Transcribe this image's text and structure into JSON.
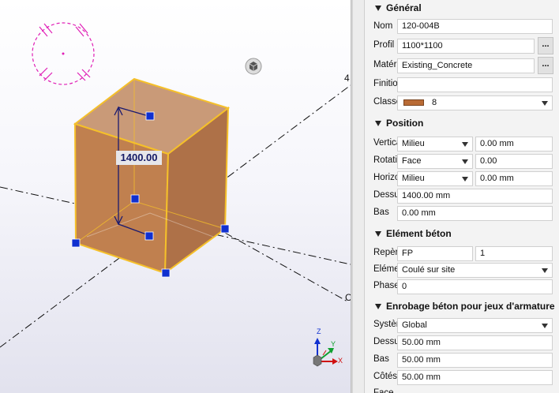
{
  "viewport": {
    "dimension_value": "1400.00",
    "edge_number_top": "4",
    "edge_number_bottom": "C",
    "axes": {
      "z": "Z",
      "y": "Y",
      "x": "X"
    },
    "colors": {
      "solid_fill": "#b87a4e",
      "highlight": "#f5c02a",
      "handle": "#1030d0",
      "dim_line": "#1a1a70"
    }
  },
  "panel": {
    "general": {
      "title": "Général",
      "nom_label": "Nom",
      "nom_value": "120-004B",
      "profil_label": "Profil",
      "profil_value": "1100*1100",
      "profil_button": "...",
      "materiau_label": "Matériau",
      "materiau_value": "Existing_Concrete",
      "materiau_button": "...",
      "finition_label": "Finition",
      "finition_value": "",
      "classe_label": "Classe",
      "classe_value": "8",
      "classe_color": "#b96b35"
    },
    "position": {
      "title": "Position",
      "verticale_label": "Verticale",
      "verticale_value": "Milieu",
      "verticale_offset": "0.00 mm",
      "rotation_label": "Rotation",
      "rotation_value": "Face",
      "rotation_offset": "0.00",
      "horizontale_label": "Horizontale",
      "horizontale_value": "Milieu",
      "horizontale_offset": "0.00 mm",
      "dessus_label": "Dessus",
      "dessus_value": "1400.00 mm",
      "bas_label": "Bas",
      "bas_value": "0.00 mm"
    },
    "element_beton": {
      "title": "Elément béton",
      "repere_label": "Repère",
      "repere_prefix": "FP",
      "repere_start": "1",
      "element_label": "Elément",
      "element_value": "Coulé sur site",
      "phase_label": "Phase",
      "phase_value": "0"
    },
    "enrobage": {
      "title": "Enrobage béton pour jeux d'armature",
      "systeme_label": "Système",
      "systeme_value": "Global",
      "dessus_label": "Dessus",
      "dessus_value": "50.00 mm",
      "bas_label": "Bas",
      "bas_value": "50.00 mm",
      "cotes_label": "Côtés",
      "cotes_value": "50.00 mm",
      "face_label": "Face"
    }
  }
}
